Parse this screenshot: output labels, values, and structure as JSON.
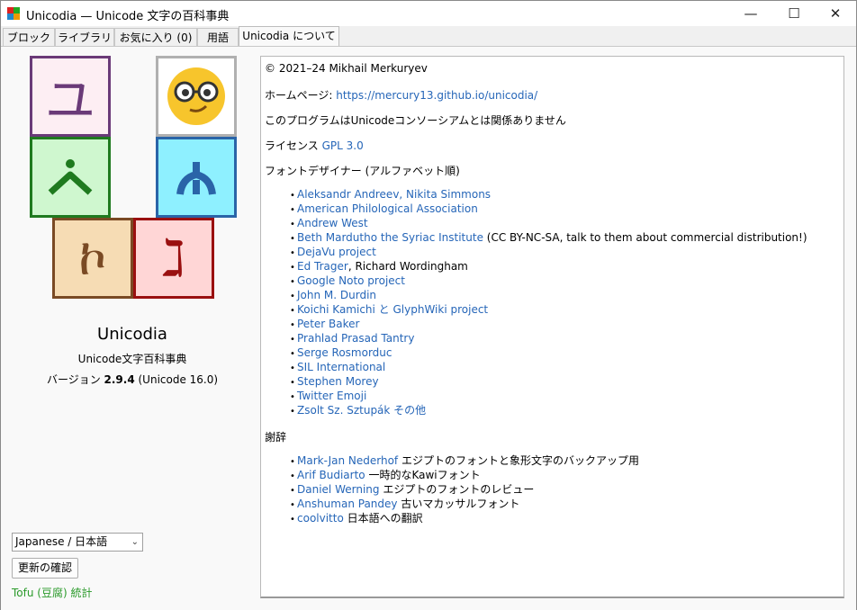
{
  "window": {
    "title": "Unicodia — Unicode 文字の百科事典",
    "controls": {
      "minimize": "—",
      "maximize": "☐",
      "close": "✕"
    }
  },
  "tabs": [
    {
      "label": "ブロック",
      "active": false
    },
    {
      "label": "ライブラリ",
      "active": false
    },
    {
      "label": "お気に入り (0)",
      "active": false
    },
    {
      "label": "用語",
      "active": false
    },
    {
      "label": "Unicodia について",
      "active": true
    }
  ],
  "logo": {
    "tiles": [
      {
        "glyph": "ユ",
        "bg": "#fdeef3",
        "border": "#6a3a78",
        "color": "#6a3a78"
      },
      {
        "glyph": "emoji-nerd-face",
        "bg": "#ffffff",
        "border": "#b0b0b0",
        "color": "#f2c12e"
      },
      {
        "glyph": "ܢ",
        "bg": "#cff7cf",
        "border": "#1f7a1f",
        "color": "#1f7a1f"
      },
      {
        "glyph": "ᐃ",
        "bg": "#8ef0ff",
        "border": "#2a64a8",
        "color": "#2a64a8"
      },
      {
        "glyph": "ኮ",
        "bg": "#f6dcb4",
        "border": "#7a4a24",
        "color": "#7a4a24"
      },
      {
        "glyph": "ℷ",
        "bg": "#ffd6d6",
        "border": "#9a1010",
        "color": "#9a1010"
      }
    ]
  },
  "app": {
    "name": "Unicodia",
    "subtitle": "Unicode文字百科事典",
    "version_prefix": "バージョン ",
    "version": "2.9.4",
    "version_suffix": " (Unicode 16.0)"
  },
  "sidebar": {
    "language": "Japanese / 日本語",
    "check_updates": "更新の確認",
    "tofu_stats": "Tofu (豆腐) 統計"
  },
  "about": {
    "copyright": "© 2021–24 Mikhail Merkuryev",
    "homepage_label": "ホームページ: ",
    "homepage_url": "https://mercury13.github.io/unicodia/",
    "disclaimer": "このプログラムはUnicodeコンソーシアムとは関係ありません",
    "license_label": "ライセンス ",
    "license": "GPL 3.0",
    "fonts_heading": "フォントデザイナー (アルファベット順)",
    "font_designers": [
      {
        "link": "Aleksandr Andreev, Nikita Simmons",
        "note": ""
      },
      {
        "link": "American Philological Association",
        "note": ""
      },
      {
        "link": "Andrew West",
        "note": ""
      },
      {
        "link": "Beth Mardutho the Syriac Institute",
        "note": " (CC BY-NC-SA, talk to them about commercial distribution!)"
      },
      {
        "link": "DejaVu project",
        "note": ""
      },
      {
        "link": "Ed Trager",
        "note": ", Richard Wordingham"
      },
      {
        "link": "Google Noto project",
        "note": ""
      },
      {
        "link": "John M. Durdin",
        "note": ""
      },
      {
        "link": "Koichi Kamichi と GlyphWiki project",
        "note": ""
      },
      {
        "link": "Peter Baker",
        "note": ""
      },
      {
        "link": "Prahlad Prasad Tantry",
        "note": ""
      },
      {
        "link": "Serge Rosmorduc",
        "note": ""
      },
      {
        "link": "SIL International",
        "note": ""
      },
      {
        "link": "Stephen Morey",
        "note": ""
      },
      {
        "link": "Twitter Emoji",
        "note": ""
      },
      {
        "link": "Zsolt Sz. Sztupák その他",
        "note": ""
      }
    ],
    "thanks_heading": "謝辞",
    "thanks": [
      {
        "link": "Mark-Jan Nederhof",
        "note": " エジプトのフォントと象形文字のバックアップ用"
      },
      {
        "link": "Arif Budiarto",
        "note": " 一時的なKawiフォント"
      },
      {
        "link": "Daniel Werning",
        "note": " エジプトのフォントのレビュー"
      },
      {
        "link": "Anshuman Pandey",
        "note": " 古いマカッサルフォント"
      },
      {
        "link": "coolvitto",
        "note": " 日本語への翻訳"
      }
    ]
  }
}
